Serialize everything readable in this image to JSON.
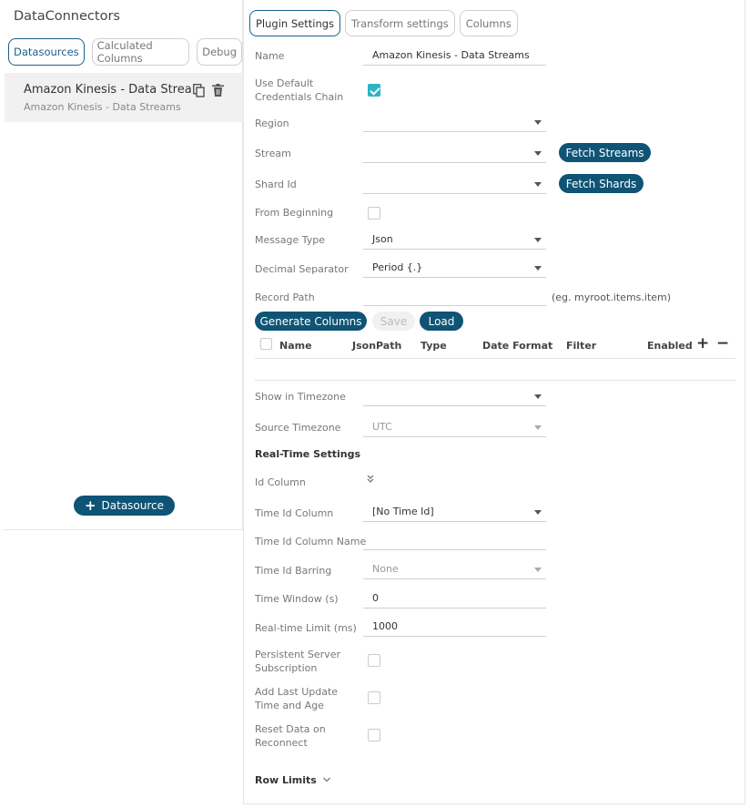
{
  "left": {
    "title": "DataConnectors",
    "tabs": [
      {
        "label": "Datasources",
        "active": true
      },
      {
        "label": "Calculated Columns",
        "active": false
      },
      {
        "label": "Debug",
        "active": false
      }
    ],
    "datasource": {
      "name": "Amazon Kinesis - Data Strea...",
      "subtitle": "Amazon Kinesis - Data Streams",
      "icons": [
        "copy-icon",
        "trash-icon"
      ]
    },
    "add_button": "Datasource"
  },
  "right": {
    "tabs": [
      {
        "label": "Plugin Settings",
        "active": true
      },
      {
        "label": "Transform settings",
        "active": false
      },
      {
        "label": "Columns",
        "active": false
      }
    ],
    "fields": {
      "name": {
        "label": "Name",
        "value": "Amazon Kinesis - Data Streams"
      },
      "credentials": {
        "label": "Use Default Credentials Chain",
        "checked": true
      },
      "region": {
        "label": "Region",
        "value": ""
      },
      "stream": {
        "label": "Stream",
        "value": ""
      },
      "shard_id": {
        "label": "Shard Id",
        "value": ""
      },
      "from_beginning": {
        "label": "From Beginning",
        "checked": false
      },
      "message_type": {
        "label": "Message Type",
        "value": "Json"
      },
      "decimal_separator": {
        "label": "Decimal Separator",
        "value": "Period {.}"
      },
      "record_path": {
        "label": "Record Path",
        "value": "",
        "hint": "(eg. myroot.items.item)"
      },
      "show_in_timezone": {
        "label": "Show in Timezone",
        "value": ""
      },
      "source_timezone": {
        "label": "Source Timezone",
        "value": "UTC"
      },
      "id_column": {
        "label": "Id Column"
      },
      "time_id_column": {
        "label": "Time Id Column",
        "value": "[No Time Id]"
      },
      "time_id_column_name": {
        "label": "Time Id Column Name",
        "value": ""
      },
      "time_id_barring": {
        "label": "Time Id Barring",
        "value": "None"
      },
      "time_window": {
        "label": "Time Window (s)",
        "value": "0"
      },
      "realtime_limit": {
        "label": "Real-time Limit (ms)",
        "value": "1000"
      },
      "persistent_sub": {
        "label": "Persistent Server Subscription",
        "checked": false
      },
      "add_last_update": {
        "label": "Add Last Update Time and Age",
        "checked": false
      },
      "reset_data": {
        "label": "Reset Data on Reconnect",
        "checked": false
      }
    },
    "buttons": {
      "fetch_streams": "Fetch Streams",
      "fetch_shards": "Fetch Shards",
      "generate_columns": "Generate Columns",
      "save": "Save",
      "load": "Load"
    },
    "table_headers": [
      "Name",
      "JsonPath",
      "Type",
      "Date Format",
      "Filter",
      "Enabled"
    ],
    "sections": {
      "realtime": "Real-Time Settings",
      "row_limits": "Row Limits"
    },
    "colors": {
      "accent": "#0f5475",
      "check": "#2bb3c6"
    }
  }
}
